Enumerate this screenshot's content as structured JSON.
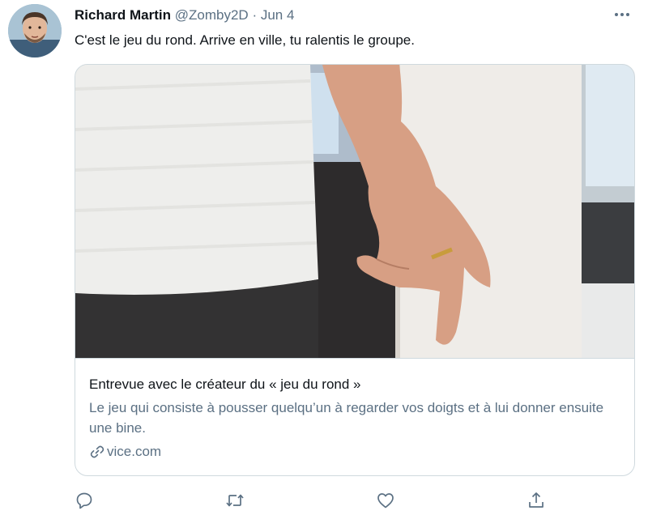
{
  "tweet": {
    "author_name": "Richard Martin",
    "author_handle": "@Zomby2D",
    "separator": " · ",
    "date": "Jun 4",
    "text": "C'est le jeu du rond. Arrive en ville, tu ralentis le groupe.",
    "more_icon": "more-horizontal-icon"
  },
  "card": {
    "title": "Entrevue avec le créateur du « jeu du rond »",
    "description": "Le jeu qui consiste à pousser quelqu’un à regarder vos doigts et à lui donner ensuite une bine.",
    "domain": "vice.com",
    "domain_icon": "link-icon"
  },
  "actions": {
    "icons": [
      "reply-icon",
      "retweet-icon",
      "like-icon",
      "share-icon"
    ]
  },
  "colors": {
    "text": "#0f1419",
    "secondary": "#5b7083",
    "border": "#cfd9de"
  }
}
